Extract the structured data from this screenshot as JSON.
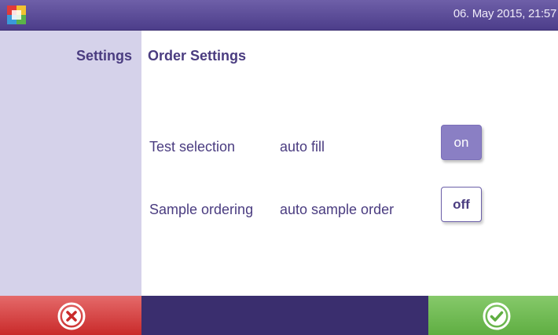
{
  "header": {
    "datetime": "06. May 2015, 21:57",
    "logo_icon": "app-logo-icon"
  },
  "sidebar": {
    "title": "Settings"
  },
  "main": {
    "title": "Order Settings",
    "rows": [
      {
        "name": "Test selection",
        "option": "auto fill",
        "toggle_label": "on",
        "toggle_state": "on"
      },
      {
        "name": "Sample ordering",
        "option": "auto sample order",
        "toggle_label": "off",
        "toggle_state": "off"
      }
    ]
  },
  "footer": {
    "cancel_icon": "close-circle-icon",
    "confirm_icon": "check-circle-icon"
  },
  "colors": {
    "header": "#5a4b96",
    "sidebar": "#d5d2ea",
    "text": "#4a3c80",
    "cancel": "#d63c3c",
    "confirm": "#70bb52",
    "toggle_on": "#8a7fc4"
  }
}
